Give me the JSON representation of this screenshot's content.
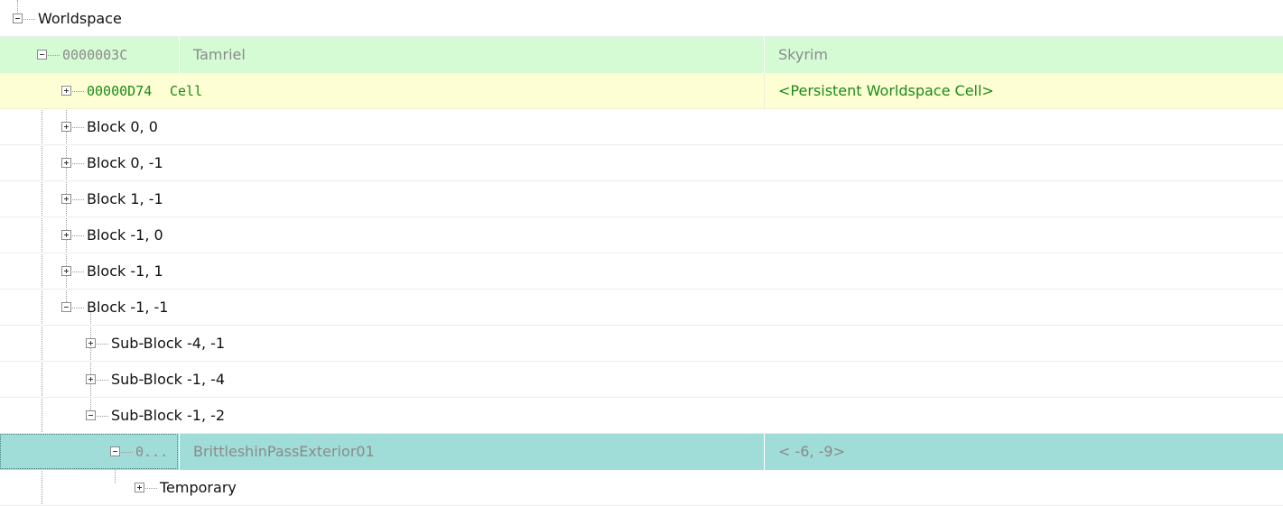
{
  "tree": {
    "root_label": "Worldspace",
    "worldspace": {
      "form_id": "0000003C",
      "editor_id": "Tamriel",
      "name": "Skyrim"
    },
    "persistent_cell": {
      "form_id": "00000D74",
      "type": "Cell",
      "name": "<Persistent Worldspace Cell>"
    },
    "blocks": [
      "Block 0, 0",
      "Block 0, -1",
      "Block 1, -1",
      "Block -1, 0",
      "Block -1, 1",
      "Block -1, -1"
    ],
    "sub_blocks": [
      "Sub-Block -4, -1",
      "Sub-Block -1, -4",
      "Sub-Block -1, -2"
    ],
    "selected_cell": {
      "form_id_truncated": "0...",
      "editor_id": "BrittleshinPassExterior01",
      "grid": "< -6,  -9>"
    },
    "temporary_label": "Temporary"
  },
  "colors": {
    "worldspace_row": "#d5fbd5",
    "persistent_row": "#fefed4",
    "selected_row": "#a0ddd8",
    "persistent_text": "#1a8a1a"
  }
}
